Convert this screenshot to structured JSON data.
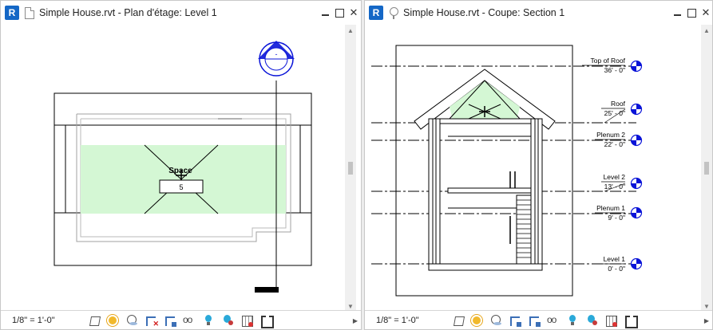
{
  "windows": {
    "left": {
      "app_letter": "R",
      "title": "Simple House.rvt - Plan d'étage: Level 1",
      "view_scale": "1/8\" = 1'-0\"",
      "room": {
        "name": "Space",
        "number": "5"
      },
      "elevation_marker": "-"
    },
    "right": {
      "app_letter": "R",
      "title": "Simple House.rvt - Coupe: Section 1",
      "view_scale": "1/8\" = 1'-0\"",
      "levels": [
        {
          "name": "Top of Roof",
          "elevation": "36' - 0\""
        },
        {
          "name": "Roof",
          "elevation": "25' - 0\""
        },
        {
          "name": "Plenum 2",
          "elevation": "22' - 0\""
        },
        {
          "name": "Level 2",
          "elevation": "13' - 0\""
        },
        {
          "name": "Plenum 1",
          "elevation": "9' - 0\""
        },
        {
          "name": "Level 1",
          "elevation": "0' - 0\""
        }
      ]
    }
  },
  "colors": {
    "space_fill": "#d4f7d4",
    "app_icon": "#1467c6",
    "marker_blue": "#0a14d8"
  },
  "icons": {
    "doc": "document-icon",
    "pin": "pin-icon",
    "minimize": "minimize-icon",
    "maximize": "maximize-icon",
    "close": "close-icon"
  }
}
